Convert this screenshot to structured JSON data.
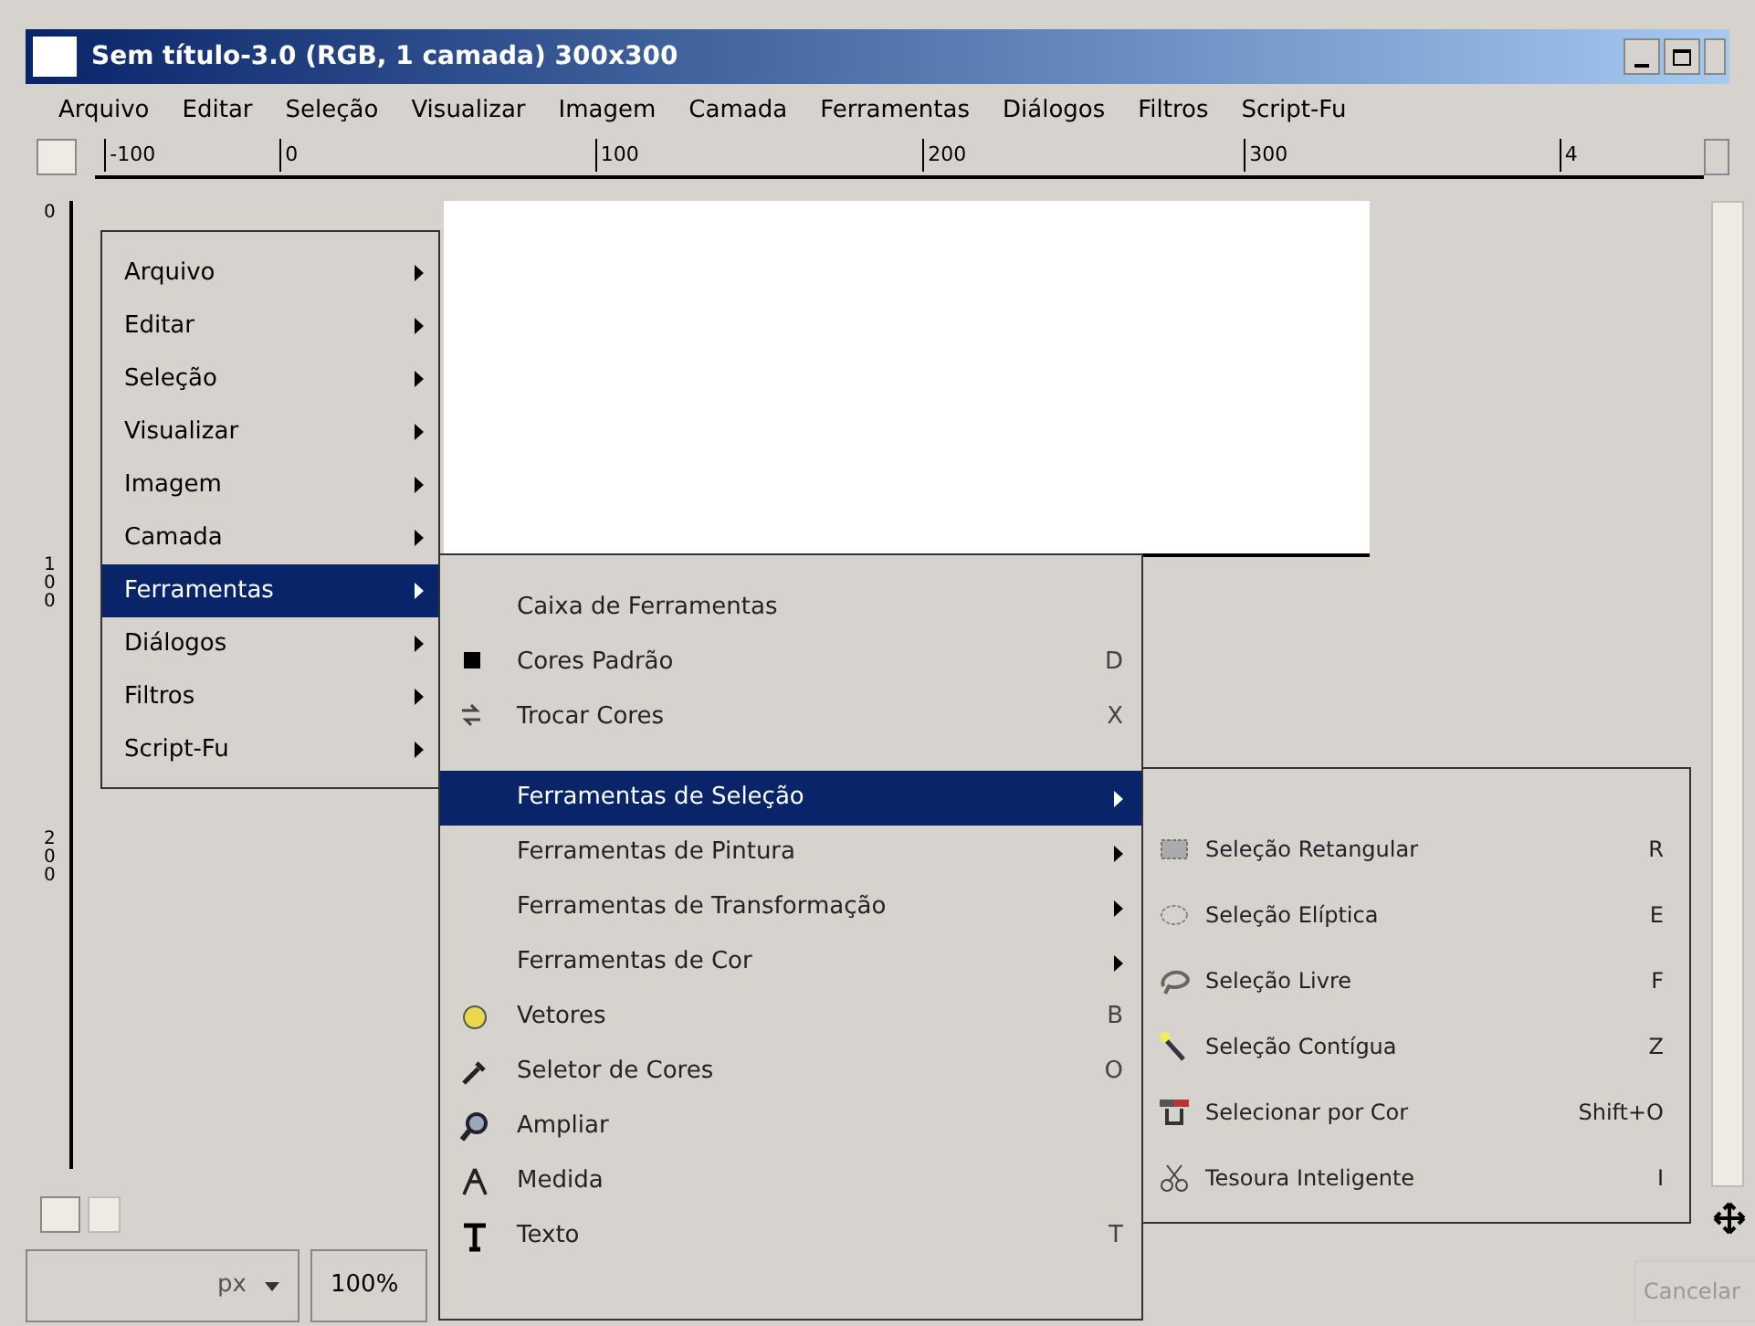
{
  "window": {
    "title": "Sem título-3.0 (RGB, 1 camada) 300x300"
  },
  "menubar": [
    "Arquivo",
    "Editar",
    "Seleção",
    "Visualizar",
    "Imagem",
    "Camada",
    "Ferramentas",
    "Diálogos",
    "Filtros",
    "Script-Fu"
  ],
  "hruler": [
    "-100",
    "0",
    "100",
    "200",
    "300",
    "4"
  ],
  "vruler": [
    "0",
    "100",
    "200"
  ],
  "menu": [
    {
      "label": "Arquivo",
      "selected": false
    },
    {
      "label": "Editar",
      "selected": false
    },
    {
      "label": "Seleção",
      "selected": false
    },
    {
      "label": "Visualizar",
      "selected": false
    },
    {
      "label": "Imagem",
      "selected": false
    },
    {
      "label": "Camada",
      "selected": false
    },
    {
      "label": "Ferramentas",
      "selected": true
    },
    {
      "label": "Diálogos",
      "selected": false
    },
    {
      "label": "Filtros",
      "selected": false
    },
    {
      "label": "Script-Fu",
      "selected": false
    }
  ],
  "tools_menu": [
    {
      "kind": "item",
      "label": "Caixa de Ferramentas",
      "selected": false
    },
    {
      "kind": "item",
      "label": "Cores Padrão",
      "shortcut": "D",
      "selected": false
    },
    {
      "kind": "item",
      "label": "Trocar Cores",
      "shortcut": "X",
      "selected": false
    },
    {
      "kind": "separator"
    },
    {
      "kind": "submenu",
      "label": "Ferramentas de Seleção",
      "selected": true
    },
    {
      "kind": "submenu",
      "label": "Ferramentas de Pintura",
      "selected": false
    },
    {
      "kind": "submenu",
      "label": "Ferramentas de Transformação",
      "selected": false
    },
    {
      "kind": "submenu",
      "label": "Ferramentas de Cor",
      "selected": false
    },
    {
      "kind": "item",
      "label": "Vetores",
      "shortcut": "B",
      "selected": false
    },
    {
      "kind": "item",
      "label": "Seletor de Cores",
      "shortcut": "O",
      "selected": false
    },
    {
      "kind": "item",
      "label": "Ampliar",
      "selected": false
    },
    {
      "kind": "item",
      "label": "Medida",
      "selected": false
    },
    {
      "kind": "item",
      "label": "Texto",
      "shortcut": "T",
      "selected": false
    }
  ],
  "selection_menu": [
    {
      "label": "Seleção Retangular",
      "shortcut": "R"
    },
    {
      "label": "Seleção Elíptica",
      "shortcut": "E"
    },
    {
      "label": "Seleção Livre",
      "shortcut": "F"
    },
    {
      "label": "Seleção Contígua",
      "shortcut": "Z"
    },
    {
      "label": "Selecionar por Cor",
      "shortcut": "Shift+O"
    },
    {
      "label": "Tesoura Inteligente",
      "shortcut": "I"
    }
  ],
  "status_bar": {
    "unit": "px",
    "zoom": "100%",
    "cancel": "Cancelar"
  }
}
